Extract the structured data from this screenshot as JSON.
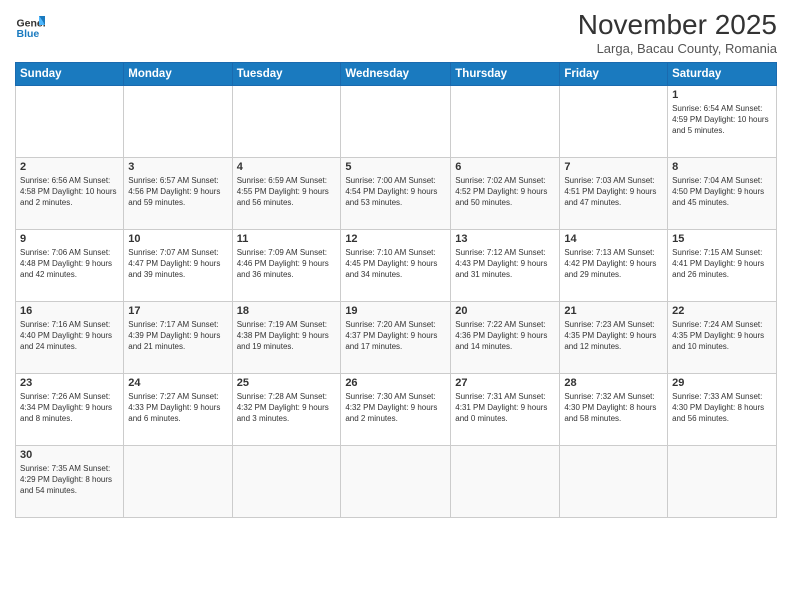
{
  "logo": {
    "text_general": "General",
    "text_blue": "Blue"
  },
  "header": {
    "month_title": "November 2025",
    "subtitle": "Larga, Bacau County, Romania"
  },
  "weekdays": [
    "Sunday",
    "Monday",
    "Tuesday",
    "Wednesday",
    "Thursday",
    "Friday",
    "Saturday"
  ],
  "weeks": [
    [
      {
        "day": "",
        "info": ""
      },
      {
        "day": "",
        "info": ""
      },
      {
        "day": "",
        "info": ""
      },
      {
        "day": "",
        "info": ""
      },
      {
        "day": "",
        "info": ""
      },
      {
        "day": "",
        "info": ""
      },
      {
        "day": "1",
        "info": "Sunrise: 6:54 AM\nSunset: 4:59 PM\nDaylight: 10 hours and 5 minutes."
      }
    ],
    [
      {
        "day": "2",
        "info": "Sunrise: 6:56 AM\nSunset: 4:58 PM\nDaylight: 10 hours and 2 minutes."
      },
      {
        "day": "3",
        "info": "Sunrise: 6:57 AM\nSunset: 4:56 PM\nDaylight: 9 hours and 59 minutes."
      },
      {
        "day": "4",
        "info": "Sunrise: 6:59 AM\nSunset: 4:55 PM\nDaylight: 9 hours and 56 minutes."
      },
      {
        "day": "5",
        "info": "Sunrise: 7:00 AM\nSunset: 4:54 PM\nDaylight: 9 hours and 53 minutes."
      },
      {
        "day": "6",
        "info": "Sunrise: 7:02 AM\nSunset: 4:52 PM\nDaylight: 9 hours and 50 minutes."
      },
      {
        "day": "7",
        "info": "Sunrise: 7:03 AM\nSunset: 4:51 PM\nDaylight: 9 hours and 47 minutes."
      },
      {
        "day": "8",
        "info": "Sunrise: 7:04 AM\nSunset: 4:50 PM\nDaylight: 9 hours and 45 minutes."
      }
    ],
    [
      {
        "day": "9",
        "info": "Sunrise: 7:06 AM\nSunset: 4:48 PM\nDaylight: 9 hours and 42 minutes."
      },
      {
        "day": "10",
        "info": "Sunrise: 7:07 AM\nSunset: 4:47 PM\nDaylight: 9 hours and 39 minutes."
      },
      {
        "day": "11",
        "info": "Sunrise: 7:09 AM\nSunset: 4:46 PM\nDaylight: 9 hours and 36 minutes."
      },
      {
        "day": "12",
        "info": "Sunrise: 7:10 AM\nSunset: 4:45 PM\nDaylight: 9 hours and 34 minutes."
      },
      {
        "day": "13",
        "info": "Sunrise: 7:12 AM\nSunset: 4:43 PM\nDaylight: 9 hours and 31 minutes."
      },
      {
        "day": "14",
        "info": "Sunrise: 7:13 AM\nSunset: 4:42 PM\nDaylight: 9 hours and 29 minutes."
      },
      {
        "day": "15",
        "info": "Sunrise: 7:15 AM\nSunset: 4:41 PM\nDaylight: 9 hours and 26 minutes."
      }
    ],
    [
      {
        "day": "16",
        "info": "Sunrise: 7:16 AM\nSunset: 4:40 PM\nDaylight: 9 hours and 24 minutes."
      },
      {
        "day": "17",
        "info": "Sunrise: 7:17 AM\nSunset: 4:39 PM\nDaylight: 9 hours and 21 minutes."
      },
      {
        "day": "18",
        "info": "Sunrise: 7:19 AM\nSunset: 4:38 PM\nDaylight: 9 hours and 19 minutes."
      },
      {
        "day": "19",
        "info": "Sunrise: 7:20 AM\nSunset: 4:37 PM\nDaylight: 9 hours and 17 minutes."
      },
      {
        "day": "20",
        "info": "Sunrise: 7:22 AM\nSunset: 4:36 PM\nDaylight: 9 hours and 14 minutes."
      },
      {
        "day": "21",
        "info": "Sunrise: 7:23 AM\nSunset: 4:35 PM\nDaylight: 9 hours and 12 minutes."
      },
      {
        "day": "22",
        "info": "Sunrise: 7:24 AM\nSunset: 4:35 PM\nDaylight: 9 hours and 10 minutes."
      }
    ],
    [
      {
        "day": "23",
        "info": "Sunrise: 7:26 AM\nSunset: 4:34 PM\nDaylight: 9 hours and 8 minutes."
      },
      {
        "day": "24",
        "info": "Sunrise: 7:27 AM\nSunset: 4:33 PM\nDaylight: 9 hours and 6 minutes."
      },
      {
        "day": "25",
        "info": "Sunrise: 7:28 AM\nSunset: 4:32 PM\nDaylight: 9 hours and 3 minutes."
      },
      {
        "day": "26",
        "info": "Sunrise: 7:30 AM\nSunset: 4:32 PM\nDaylight: 9 hours and 2 minutes."
      },
      {
        "day": "27",
        "info": "Sunrise: 7:31 AM\nSunset: 4:31 PM\nDaylight: 9 hours and 0 minutes."
      },
      {
        "day": "28",
        "info": "Sunrise: 7:32 AM\nSunset: 4:30 PM\nDaylight: 8 hours and 58 minutes."
      },
      {
        "day": "29",
        "info": "Sunrise: 7:33 AM\nSunset: 4:30 PM\nDaylight: 8 hours and 56 minutes."
      }
    ],
    [
      {
        "day": "30",
        "info": "Sunrise: 7:35 AM\nSunset: 4:29 PM\nDaylight: 8 hours and 54 minutes."
      },
      {
        "day": "",
        "info": ""
      },
      {
        "day": "",
        "info": ""
      },
      {
        "day": "",
        "info": ""
      },
      {
        "day": "",
        "info": ""
      },
      {
        "day": "",
        "info": ""
      },
      {
        "day": "",
        "info": ""
      }
    ]
  ]
}
